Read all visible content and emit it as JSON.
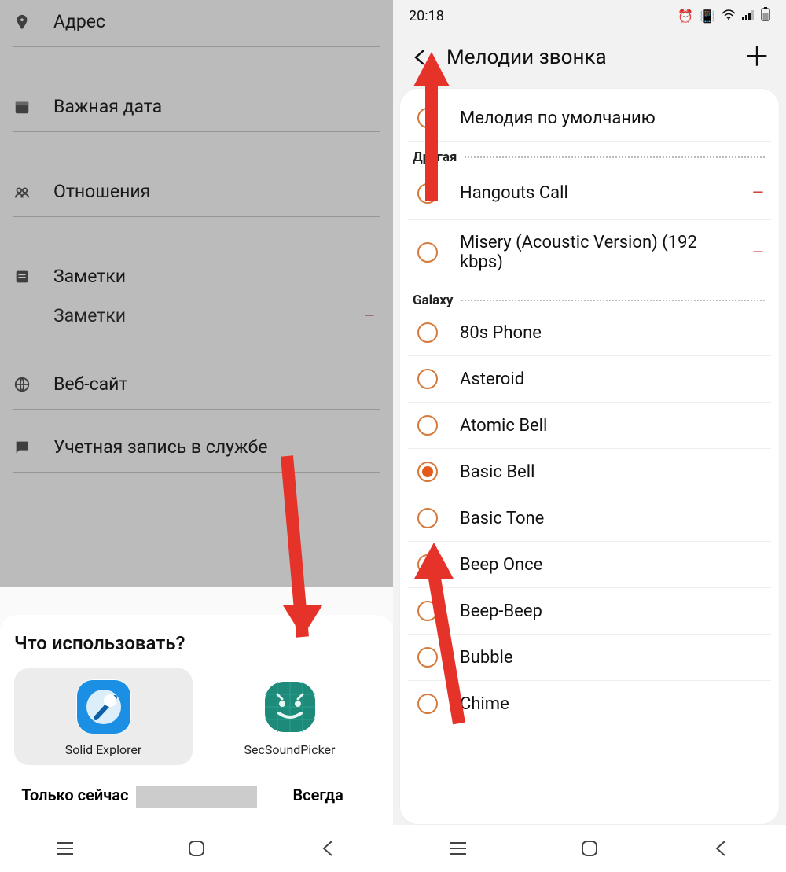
{
  "left": {
    "fields": {
      "address": "Адрес",
      "date": "Важная дата",
      "relations": "Отношения",
      "notes": "Заметки",
      "notes_sub": "Заметки",
      "website": "Веб-сайт",
      "account": "Учетная запись в службе"
    },
    "sheet": {
      "title": "Что использовать?",
      "app1": "Solid Explorer",
      "app2": "SecSoundPicker",
      "just_now": "Только сейчас",
      "always": "Всегда"
    }
  },
  "right": {
    "time": "20:18",
    "title": "Мелодии звонка",
    "default": "Мелодия по умолчанию",
    "section_other": "Другая",
    "section_galaxy": "Galaxy",
    "items_other": [
      {
        "label": "Hangouts Call",
        "minus": true
      },
      {
        "label": "Misery (Acoustic Version) (192  kbps)",
        "minus": true
      }
    ],
    "items_galaxy": [
      {
        "label": "80s Phone",
        "selected": false
      },
      {
        "label": "Asteroid",
        "selected": false
      },
      {
        "label": "Atomic Bell",
        "selected": false
      },
      {
        "label": "Basic Bell",
        "selected": true
      },
      {
        "label": "Basic Tone",
        "selected": false
      },
      {
        "label": "Beep Once",
        "selected": false
      },
      {
        "label": "Beep-Beep",
        "selected": false
      },
      {
        "label": "Bubble",
        "selected": false
      },
      {
        "label": "Chime",
        "selected": false
      }
    ]
  }
}
